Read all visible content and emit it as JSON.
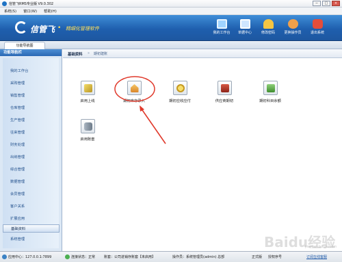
{
  "window": {
    "title": "信管飞RMS专业版 V9.0.302",
    "min": "−",
    "max": "□",
    "close": "×"
  },
  "menu": {
    "items": [
      "系统(S)",
      "窗口(W)",
      "帮助(H)"
    ]
  },
  "banner": {
    "logo": "信管飞",
    "slogan": "精细化管理软件",
    "buttons": [
      {
        "label": "我的工作台",
        "icon": "monitor-icon",
        "color": "#9fd3ff"
      },
      {
        "label": "单据中心",
        "icon": "document-icon",
        "color": "#cfe6ff"
      },
      {
        "label": "修改密码",
        "icon": "key-icon",
        "color": "#f5c542"
      },
      {
        "label": "更换操作员",
        "icon": "user-icon",
        "color": "#f0a04b"
      },
      {
        "label": "退出系统",
        "icon": "exit-icon",
        "color": "#e44d3a"
      }
    ]
  },
  "tabs": {
    "home": "功能导航图"
  },
  "sidebar": {
    "title": "功能导航栏",
    "items": [
      "我的工作台",
      "采购管理",
      "销售管理",
      "仓库管理",
      "生产管理",
      "往来管理",
      "财务处理",
      "出纳管理",
      "综合管理",
      "数据管理",
      "会员管理",
      "客户关系",
      "扩展应用",
      "基础资料",
      "系统管理"
    ],
    "active_index": 13
  },
  "breadcrumb": {
    "section": "基础资料",
    "separator": "»",
    "current": "期初建账"
  },
  "functions": [
    {
      "label": "启用上线",
      "icon": "launch-icon",
      "color": "#d4b43c"
    },
    {
      "label": "期初库存录入",
      "icon": "warehouse-icon",
      "color": "#e8a23b"
    },
    {
      "label": "期初应收应付",
      "icon": "coins-icon",
      "color": "#e6c347"
    },
    {
      "label": "供应商期初",
      "icon": "box-icon",
      "color": "#c0392b"
    },
    {
      "label": "期初科目余额",
      "icon": "ledger-icon",
      "color": "#5fae4a"
    },
    {
      "label": "启用账套",
      "icon": "database-icon",
      "color": "#7a8a99"
    }
  ],
  "status": {
    "server": "应用中心：127.0.0.1:7899",
    "connection": "连接状态：正常",
    "account": "账套：公司进销存账套【未启用】",
    "operator": "操作员：系统管理员(admin) 总部",
    "version": "正式版",
    "license": "授权序号",
    "online": "订阅在线客服"
  },
  "watermark": {
    "text": "Baidu经验",
    "url": "jingyan.baidu.com"
  },
  "colors": {
    "banner": "#2a6dbf",
    "sidebar": "#dce8f5",
    "annotation": "#e0392b"
  }
}
